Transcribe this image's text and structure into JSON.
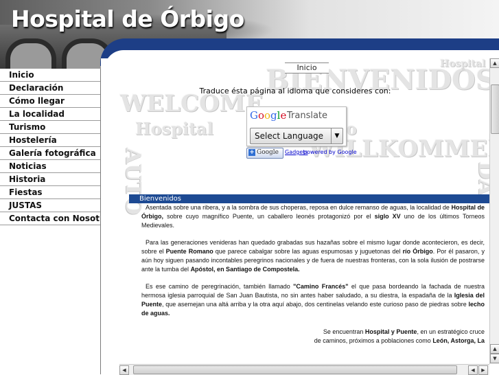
{
  "header": {
    "title": "Hospital de Órbigo"
  },
  "nav": {
    "items": [
      {
        "label": "Inicio"
      },
      {
        "label": "Declaración"
      },
      {
        "label": "Cómo llegar"
      },
      {
        "label": "La localidad"
      },
      {
        "label": "Turismo"
      },
      {
        "label": "Hostelería"
      },
      {
        "label": "Galería fotográfica"
      },
      {
        "label": "Noticias"
      },
      {
        "label": "Historia"
      },
      {
        "label": "Fiestas"
      },
      {
        "label": "JUSTAS"
      },
      {
        "label": "Contacta con Nosotros"
      }
    ]
  },
  "watermarks": {
    "bienvenidos": "BIENVENIDOS",
    "hospital_top": "Hospital",
    "welcome": "WELCOME",
    "hospital": "Hospital",
    "hospital_suffix": "o",
    "willkommen": "WILLKOMMEN",
    "left_vertical": "AUTO",
    "right_vertical": "DA"
  },
  "content": {
    "tab_label": "Inicio",
    "translate_prompt": "Traduce ésta página al idioma que consideres con:",
    "translate": {
      "logo_letters": [
        "G",
        "o",
        "o",
        "g",
        "l",
        "e"
      ],
      "translate_word": "Translate",
      "select_value": "Select Language",
      "gadget_button_label": "Google",
      "gadgets_link": "Gadgets",
      "powered_by": "powered by Google"
    },
    "panel_title": "Bienvenidos",
    "paragraphs": [
      [
        {
          "t": "Asentada sobre una ribera, y a la sombra de sus choperas, reposa en dulce remanso de aguas, la localidad de "
        },
        {
          "t": "Hospital de Órbigo,",
          "b": true
        },
        {
          "t": " sobre cuyo magnífico Puente, un caballero leonés protagonizó por el "
        },
        {
          "t": "siglo XV",
          "b": true
        },
        {
          "t": " uno de los últimos Torneos Medievales."
        }
      ],
      [
        {
          "t": "Para las generaciones venideras han quedado grabadas sus hazañas sobre el mismo lugar donde acontecieron, es decir, sobre el "
        },
        {
          "t": "Puente Romano",
          "b": true
        },
        {
          "t": " que parece cabalgar sobre las aguas espumosas y juguetonas del "
        },
        {
          "t": "río Órbigo",
          "b": true
        },
        {
          "t": ". Por él pasaron, y aún hoy siguen pasando incontables peregrinos nacionales y de fuera de nuestras fronteras, con la sola ilusión de postrarse ante la tumba del "
        },
        {
          "t": "Apóstol, en Santiago de Compostela.",
          "b": true
        }
      ],
      [
        {
          "t": "Es ese camino de peregrinación, también llamado "
        },
        {
          "t": "\"Camino Francés\"",
          "b": true
        },
        {
          "t": " el que pasa bordeando la fachada de nuestra hermosa iglesia parroquial de San Juan Bautista, no sin antes haber saludado, a su diestra, la espadaña de la "
        },
        {
          "t": "Iglesia del Puente",
          "b": true
        },
        {
          "t": ", que asemejan una altá arriba y la otra aquí abajo, dos centinelas velando este curioso paso de piedras sobre "
        },
        {
          "t": "lecho de aguas.",
          "b": true
        }
      ]
    ],
    "last_line_1": [
      {
        "t": "Se encuentran "
      },
      {
        "t": "Hospital y Puente",
        "b": true
      },
      {
        "t": ", en un estratégico cruce"
      }
    ],
    "last_line_2": [
      {
        "t": "de caminos, próximos a poblaciones como "
      },
      {
        "t": "León, Astorga, La",
        "b": true
      }
    ]
  },
  "scrollbars": {
    "up_arrow": "▲",
    "down_arrow": "▼",
    "left_arrow": "◀",
    "right_arrow": "▶",
    "grip": "⋮⋮⋮",
    "h_grip": "⁞⁞⁞"
  }
}
